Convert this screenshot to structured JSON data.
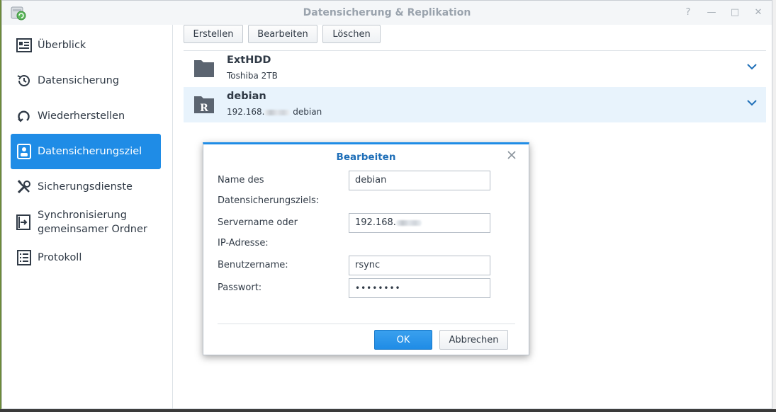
{
  "window": {
    "title": "Datensicherung & Replikation",
    "help_glyph": "?",
    "minimize_glyph": "—",
    "maximize_glyph": "□",
    "close_glyph": "✕"
  },
  "sidebar": {
    "items": [
      {
        "label": "Überblick",
        "icon": "overview-icon"
      },
      {
        "label": "Datensicherung",
        "icon": "backup-history-icon"
      },
      {
        "label": "Wiederherstellen",
        "icon": "restore-icon"
      },
      {
        "label": "Datensicherungsziel",
        "icon": "destination-icon",
        "active": true
      },
      {
        "label": "Sicherungsdienste",
        "icon": "tools-icon"
      },
      {
        "label": "Synchronisierung gemeinsamer Ordner",
        "icon": "sync-folder-icon"
      },
      {
        "label": "Protokoll",
        "icon": "log-icon"
      }
    ]
  },
  "toolbar": {
    "create_label": "Erstellen",
    "edit_label": "Bearbeiten",
    "delete_label": "Löschen"
  },
  "destinations": [
    {
      "name": "ExtHDD",
      "sub": "Toshiba 2TB",
      "icon": "folder-icon"
    },
    {
      "name": "debian",
      "sub_prefix": "192.168.",
      "sub_suffix": "debian",
      "icon": "rsync-folder-icon",
      "badge": "R",
      "selected": true
    }
  ],
  "dialog": {
    "title": "Bearbeiten",
    "name_label_1": "Name des",
    "name_label_2": "Datensicherungsziels:",
    "name_value": "debian",
    "server_label_1": "Servername oder",
    "server_label_2": "IP-Adresse:",
    "server_value": "192.168.",
    "user_label": "Benutzername:",
    "user_value": "rsync",
    "password_label": "Passwort:",
    "password_value": "••••••••",
    "ok_label": "OK",
    "cancel_label": "Abbrechen"
  },
  "colors": {
    "accent": "#1f8ce6",
    "dialog_title": "#1f6fb8",
    "text": "#303a46",
    "selected_row": "#e8f3fc"
  }
}
